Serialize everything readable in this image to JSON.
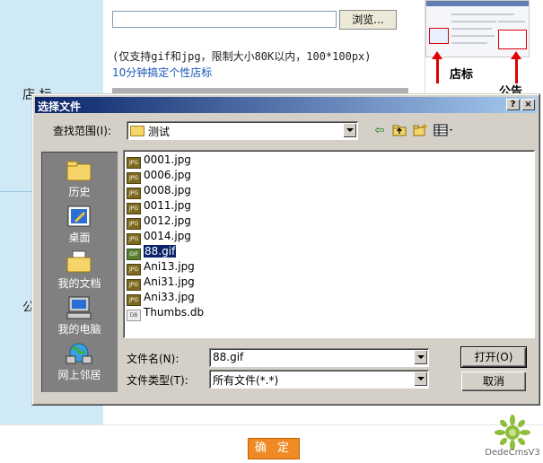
{
  "webpage": {
    "side_label_1": "店 标",
    "side_label_2": "公",
    "browse_label": "浏览...",
    "upload_hint": "(仅支持gif和jpg，限制大小80K以内，100*100px)",
    "help_link": "10分钟搞定个性店标",
    "preview_label_shop": "店标",
    "preview_label_notice": "公告",
    "confirm_label": "确 定",
    "logo_text": "DedeCmsV3"
  },
  "dialog": {
    "title": "选择文件",
    "help_btn": "?",
    "close_btn": "×",
    "look_in_label": "查找范围(I):",
    "look_in_value": "测试",
    "places": [
      {
        "label": "历史",
        "icon": "history-icon"
      },
      {
        "label": "桌面",
        "icon": "desktop-icon"
      },
      {
        "label": "我的文档",
        "icon": "my-documents-icon"
      },
      {
        "label": "我的电脑",
        "icon": "my-computer-icon"
      },
      {
        "label": "网上邻居",
        "icon": "network-places-icon"
      }
    ],
    "files": [
      {
        "name": "0001.jpg",
        "type": "JPG"
      },
      {
        "name": "0006.jpg",
        "type": "JPG"
      },
      {
        "name": "0008.jpg",
        "type": "JPG"
      },
      {
        "name": "0011.jpg",
        "type": "JPG"
      },
      {
        "name": "0012.jpg",
        "type": "JPG"
      },
      {
        "name": "0014.jpg",
        "type": "JPG"
      },
      {
        "name": "88.gif",
        "type": "GIF",
        "selected": true
      },
      {
        "name": "Ani13.jpg",
        "type": "JPG"
      },
      {
        "name": "Ani31.jpg",
        "type": "JPG"
      },
      {
        "name": "Ani33.jpg",
        "type": "JPG"
      },
      {
        "name": "Thumbs.db",
        "type": "DB"
      }
    ],
    "file_name_label": "文件名(N):",
    "file_name_value": "88.gif",
    "file_type_label": "文件类型(T):",
    "file_type_value": "所有文件(*.*)",
    "open_label": "打开(O)",
    "cancel_label": "取消"
  },
  "colors": {
    "titlebar_start": "#0a246a",
    "titlebar_end": "#a6caf0",
    "dialog_face": "#d4d0c8",
    "confirm_button": "#f08a24",
    "link": "#1a55b8"
  }
}
